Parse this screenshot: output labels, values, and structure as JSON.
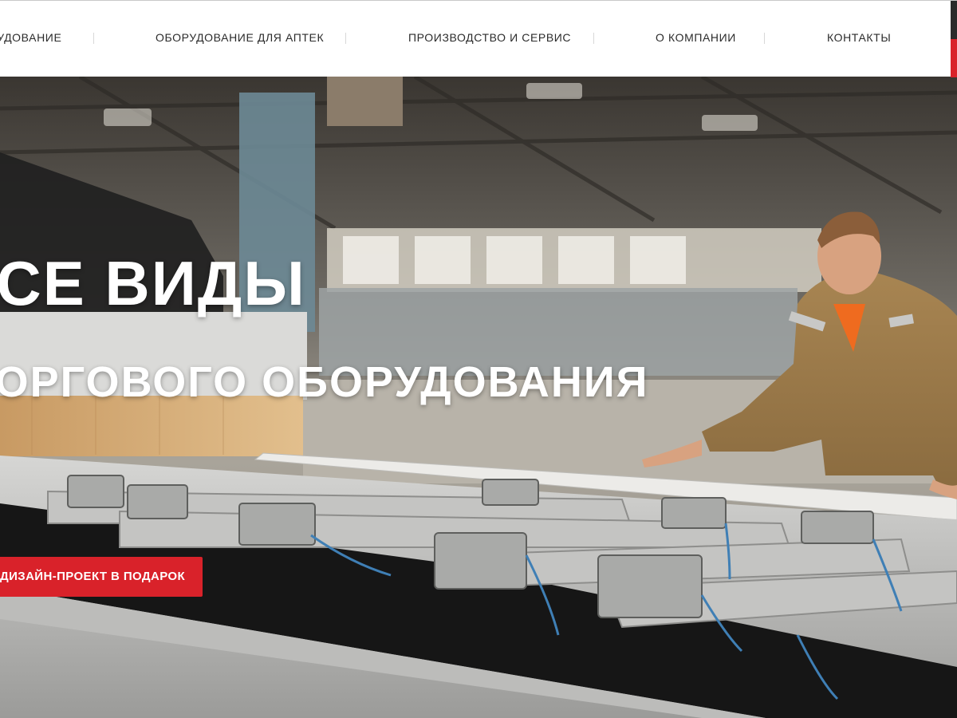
{
  "nav": {
    "items": [
      {
        "label": "ОБОРУДОВАНИЕ"
      },
      {
        "label": "ОБОРУДОВАНИЕ ДЛЯ АПТЕК"
      },
      {
        "label": "ПРОИЗВОДСТВО И СЕРВИС"
      },
      {
        "label": "О КОМПАНИИ"
      },
      {
        "label": "КОНТАКТЫ"
      }
    ]
  },
  "hero": {
    "title": "ВСЕ ВИДЫ",
    "subtitle": "ТОРГОВОГО ОБОРУДОВАНИЯ",
    "cta_label": "ДИЗАЙН-ПРОЕКТ В ПОДАРОК",
    "image_icon": "factory-worker-photo"
  },
  "colors": {
    "accent": "#d9222a",
    "nav_text": "#2b2b2b",
    "hero_text": "#ffffff"
  }
}
